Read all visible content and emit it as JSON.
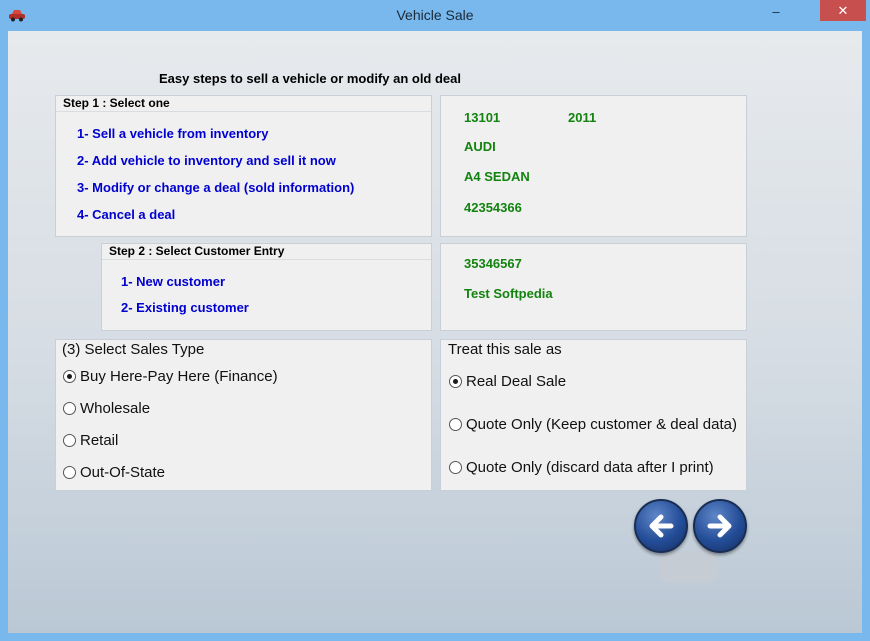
{
  "window": {
    "title": "Vehicle Sale",
    "minimize_glyph": "–",
    "close_glyph": "✕"
  },
  "heading": "Easy steps to sell a vehicle or modify an old deal",
  "step1": {
    "title": "Step 1 : Select one",
    "options": [
      "1- Sell a vehicle from inventory",
      "2- Add vehicle to inventory and sell it now",
      "3- Modify or change a deal (sold information)",
      "4- Cancel a deal"
    ]
  },
  "vehicle_info": {
    "stock_number": "13101",
    "year": "2011",
    "make": "AUDI",
    "model": "A4 SEDAN",
    "vin": "42354366"
  },
  "step2": {
    "title": "Step 2 : Select Customer Entry",
    "options": [
      "1- New customer",
      "2- Existing customer"
    ]
  },
  "customer_info": {
    "customer_id": "35346567",
    "name": "Test Softpedia"
  },
  "sales_type": {
    "label": "(3) Select Sales Type",
    "options": [
      {
        "label": "Buy Here-Pay Here (Finance)",
        "checked": true
      },
      {
        "label": "Wholesale",
        "checked": false
      },
      {
        "label": "Retail",
        "checked": false
      },
      {
        "label": "Out-Of-State",
        "checked": false
      }
    ]
  },
  "treat_sale": {
    "label": "Treat this sale as",
    "options": [
      {
        "label": "Real Deal Sale",
        "checked": true
      },
      {
        "label": "Quote Only (Keep customer & deal data)",
        "checked": false
      },
      {
        "label": "Quote Only (discard data after I print)",
        "checked": false
      }
    ]
  },
  "icons": {
    "back": "arrow-left-icon",
    "next": "arrow-right-icon",
    "app": "car-icon"
  },
  "colors": {
    "link": "#0000d0",
    "value": "#13830f",
    "titlebar": "#79b8ec",
    "close": "#c7504f"
  }
}
